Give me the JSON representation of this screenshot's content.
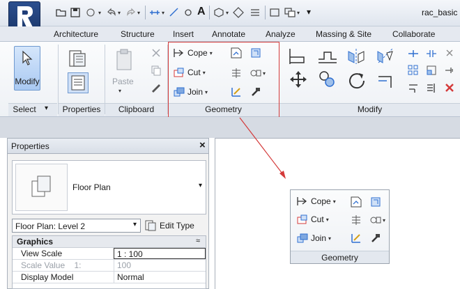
{
  "app": {
    "button_label": "A",
    "file_name": "rac_basic"
  },
  "tabs": [
    "Architecture",
    "Structure",
    "Insert",
    "Annotate",
    "Analyze",
    "Massing & Site",
    "Collaborate"
  ],
  "active_tab": "Modify",
  "ribbon": {
    "select": {
      "big_label": "Modify",
      "panel": "Select",
      "panel_arrow": "▾"
    },
    "properties": {
      "panel": "Properties"
    },
    "clipboard": {
      "paste": "Paste",
      "panel": "Clipboard"
    },
    "geometry": {
      "cope": "Cope",
      "cut": "Cut",
      "join": "Join",
      "panel": "Geometry"
    },
    "modify": {
      "panel": "Modify"
    }
  },
  "properties_palette": {
    "title": "Properties",
    "close": "×",
    "type_name": "Floor Plan",
    "instance_selector": "Floor Plan: Level 2",
    "edit_type": "Edit Type",
    "group": "Graphics",
    "collapse": "≈",
    "rows": [
      {
        "name": "View Scale",
        "value": "1 : 100"
      },
      {
        "name": "Scale Value    1:",
        "value": "100"
      },
      {
        "name": "Display Model",
        "value": "Normal"
      }
    ]
  },
  "zoom_callout": {
    "cope": "Cope",
    "cut": "Cut",
    "join": "Join",
    "panel": "Geometry"
  },
  "colors": {
    "highlight": "#d43a3a",
    "app_button": "#1f3d78",
    "accent_blue": "#2f6fd0"
  }
}
